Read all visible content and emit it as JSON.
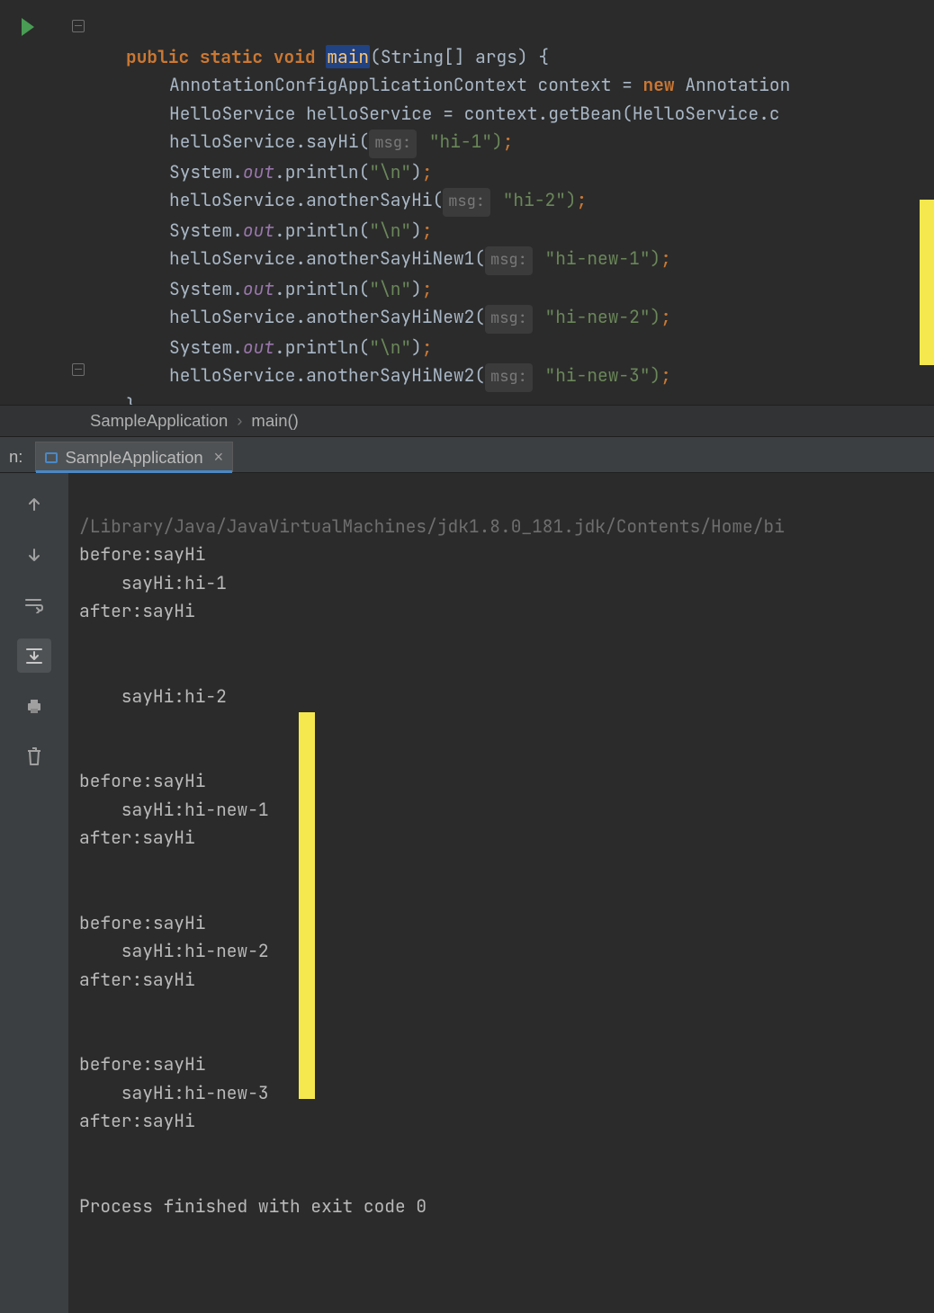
{
  "code": {
    "keywords": {
      "public": "public",
      "static": "static",
      "void": "void",
      "new": "new"
    },
    "main": "main",
    "sig_open": "(String[] args) {",
    "lines": {
      "ctx": "AnnotationConfigApplicationContext context = ",
      "ctx_tail": " Annotation",
      "svc": "HelloService helloService = context.getBean(HelloService.c",
      "say1a": "helloService.sayHi(",
      "hint1": "msg:",
      "say1b": " \"hi-1\")",
      "sys_a": "System.",
      "out": "out",
      "println_a": ".println(",
      "nlstr": "\"\\n\"",
      "another_a": "helloService.anotherSayHi(",
      "hint2": "msg:",
      "another_b": " \"hi-2\")",
      "new1_a": "helloService.anotherSayHiNew1(",
      "hint3": "msg:",
      "new1_b": " \"hi-new-1\")",
      "new2_a": "helloService.anotherSayHiNew2(",
      "hint4": "msg:",
      "new2_b": " \"hi-new-2\")",
      "new3_a": "helloService.anotherSayHiNew2(",
      "hint5": "msg:",
      "new3_b": " \"hi-new-3\")",
      "close_brace": "}"
    },
    "semi": ";",
    "close_paren": ")"
  },
  "breadcrumbs": {
    "class": "SampleApplication",
    "method": "main()"
  },
  "run": {
    "label": "n:",
    "tab": "SampleApplication"
  },
  "console": {
    "cmd": "/Library/Java/JavaVirtualMachines/jdk1.8.0_181.jdk/Contents/Home/bi",
    "lines": [
      "before:sayHi",
      "    sayHi:hi-1",
      "after:sayHi",
      "",
      "",
      "    sayHi:hi-2",
      "",
      "",
      "before:sayHi",
      "    sayHi:hi-new-1",
      "after:sayHi",
      "",
      "",
      "before:sayHi",
      "    sayHi:hi-new-2",
      "after:sayHi",
      "",
      "",
      "before:sayHi",
      "    sayHi:hi-new-3",
      "after:sayHi",
      "",
      "",
      "Process finished with exit code 0"
    ]
  }
}
